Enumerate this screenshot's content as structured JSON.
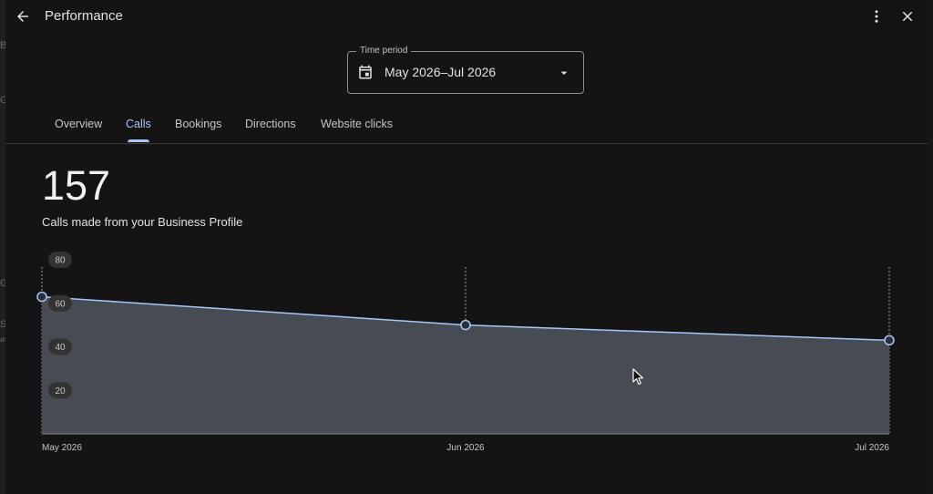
{
  "window": {
    "title": "Performance"
  },
  "time_period": {
    "label": "Time period",
    "value": "May 2026–Jul 2026"
  },
  "tabs": [
    {
      "label": "Overview",
      "active": false
    },
    {
      "label": "Calls",
      "active": true
    },
    {
      "label": "Bookings",
      "active": false
    },
    {
      "label": "Directions",
      "active": false
    },
    {
      "label": "Website clicks",
      "active": false
    }
  ],
  "metric": {
    "value": "157",
    "description": "Calls made from your Business Profile"
  },
  "background_fragments": [
    "B",
    "G",
    "G",
    "S",
    "av"
  ],
  "chart_data": {
    "type": "area",
    "x": [
      "May 2026",
      "Jun 2026",
      "Jul 2026"
    ],
    "series": [
      {
        "values": [
          63,
          50,
          43
        ]
      }
    ],
    "yticks": [
      20,
      40,
      60,
      80
    ],
    "ylim": [
      0,
      80
    ],
    "grid": "vertical dashed",
    "colors": {
      "line": "#a8c7fa",
      "fill": "#464b54"
    }
  },
  "colors": {
    "accent": "#a8c7fa",
    "background": "#141414"
  }
}
